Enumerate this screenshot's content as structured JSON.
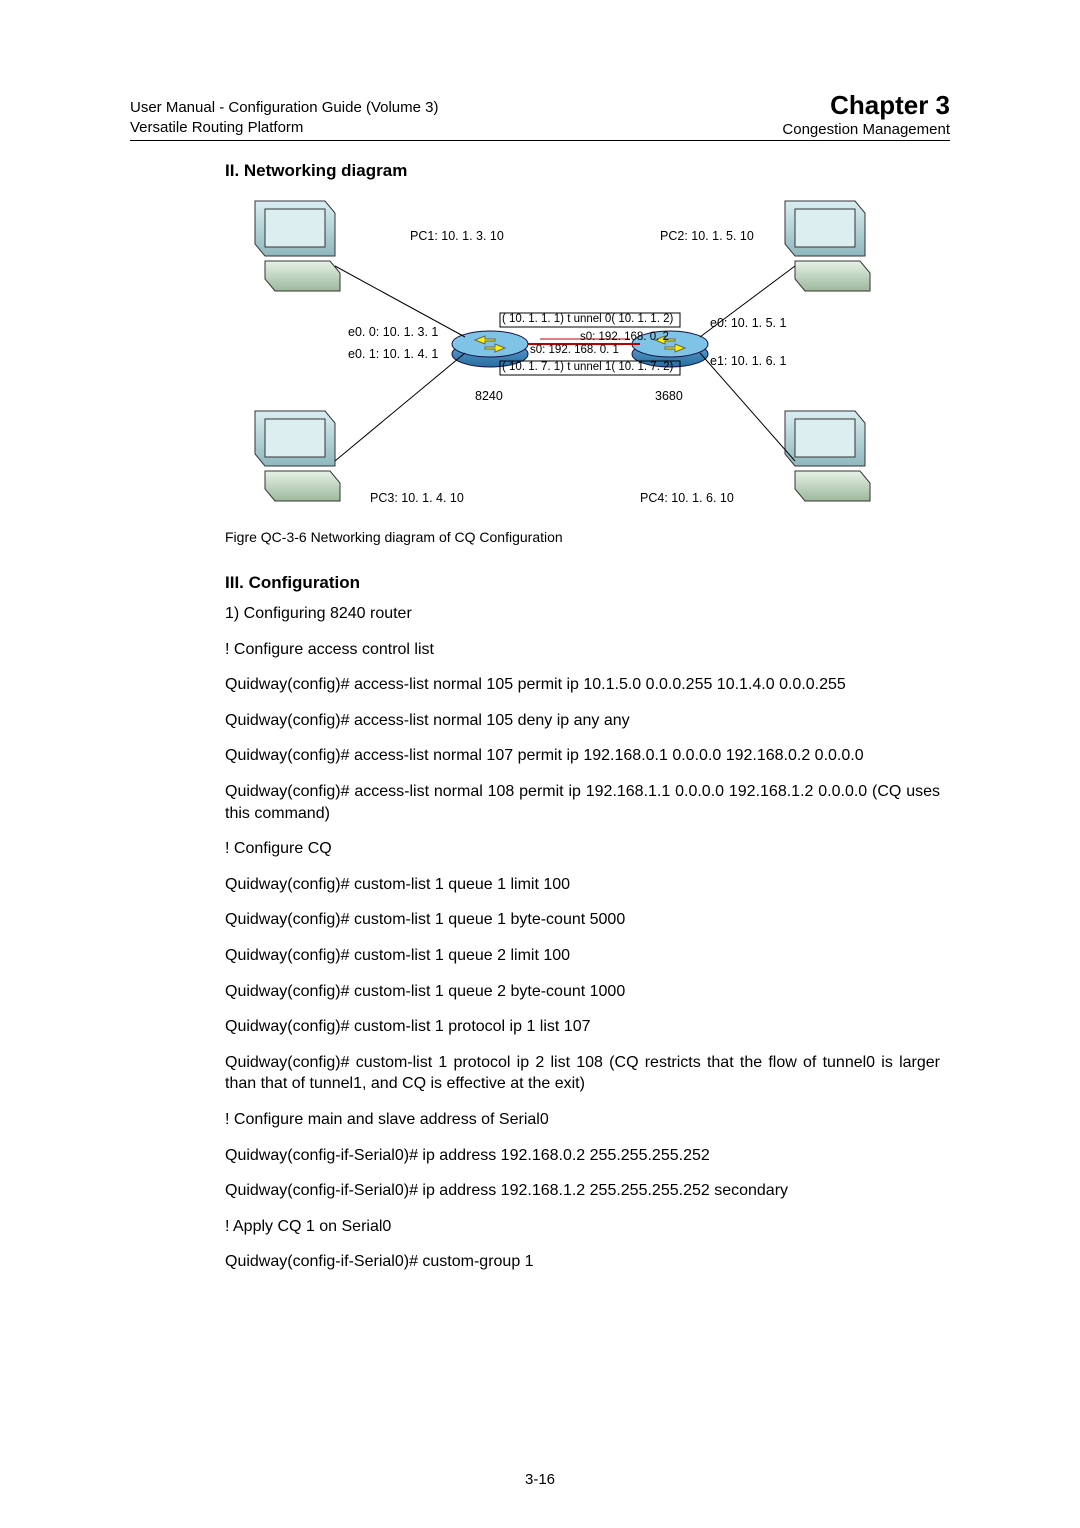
{
  "header": {
    "left_line1": "User Manual - Configuration Guide (Volume 3)",
    "left_line2": "Versatile Routing Platform",
    "right_title": "Chapter 3",
    "right_sub": "Congestion Management"
  },
  "sections": {
    "diagram_title": "II. Networking diagram",
    "config_title": "III. Configuration"
  },
  "diagram": {
    "pc1": "PC1: 10. 1. 3. 10",
    "pc2": "PC2: 10. 1. 5. 10",
    "pc3": "PC3: 10. 1. 4. 10",
    "pc4": "PC4: 10. 1. 6. 10",
    "e00": "e0. 0: 10. 1. 3. 1",
    "e01": "e0. 1: 10. 1. 4. 1",
    "e0r": "e0: 10. 1. 5. 1",
    "e1r": "e1: 10. 1. 6. 1",
    "tunnel0": "( 10. 1. 1. 1) t unnel 0( 10. 1. 1. 2)",
    "tunnel1": "( 10. 1. 7. 1) t unnel 1( 10. 1. 7. 2)",
    "s0_top": "s0: 192. 168. 0. 2",
    "s0_bot": "s0: 192. 168. 0. 1",
    "rtr_left": "8240",
    "rtr_right": "3680"
  },
  "fig_caption": "Figre QC-3-6  Networking diagram of CQ Configuration",
  "body": {
    "l1": "1)    Configuring 8240 router",
    "l2": "! Configure access control list",
    "l3": "Quidway(config)#  access-list  normal  105  permit  ip  10.1.5.0  0.0.0.255  10.1.4.0 0.0.0.255",
    "l4": "Quidway(config)# access-list normal 105 deny ip any any",
    "l5": "Quidway(config)#  access-list  normal  107  permit  ip  192.168.0.1  0.0.0.0  192.168.0.2 0.0.0.0",
    "l6": "Quidway(config)#  access-list  normal  108  permit  ip  192.168.1.1  0.0.0.0  192.168.1.2 0.0.0.0  (CQ uses this command)",
    "l7": "! Configure CQ",
    "l8": "Quidway(config)# custom-list 1 queue 1 limit 100",
    "l9": "Quidway(config)# custom-list 1 queue 1 byte-count 5000",
    "l10": "Quidway(config)# custom-list 1 queue 2 limit 100",
    "l11": "Quidway(config)# custom-list 1 queue 2 byte-count 1000",
    "l12": "Quidway(config)# custom-list 1 protocol ip 1 list 107",
    "l13": "Quidway(config)#  custom-list  1  protocol  ip  2  list  108  (CQ  restricts  that  the  flow  of tunnel0 is larger than that of tunnel1, and CQ is effective at the exit)",
    "l14": "! Configure main and slave address of Serial0",
    "l15": "Quidway(config-if-Serial0)# ip address 192.168.0.2 255.255.255.252",
    "l16": "Quidway(config-if-Serial0)# ip address 192.168.1.2 255.255.255.252 secondary",
    "l17": "! Apply CQ 1 on Serial0",
    "l18": "Quidway(config-if-Serial0)# custom-group 1"
  },
  "page_num": "3-16"
}
